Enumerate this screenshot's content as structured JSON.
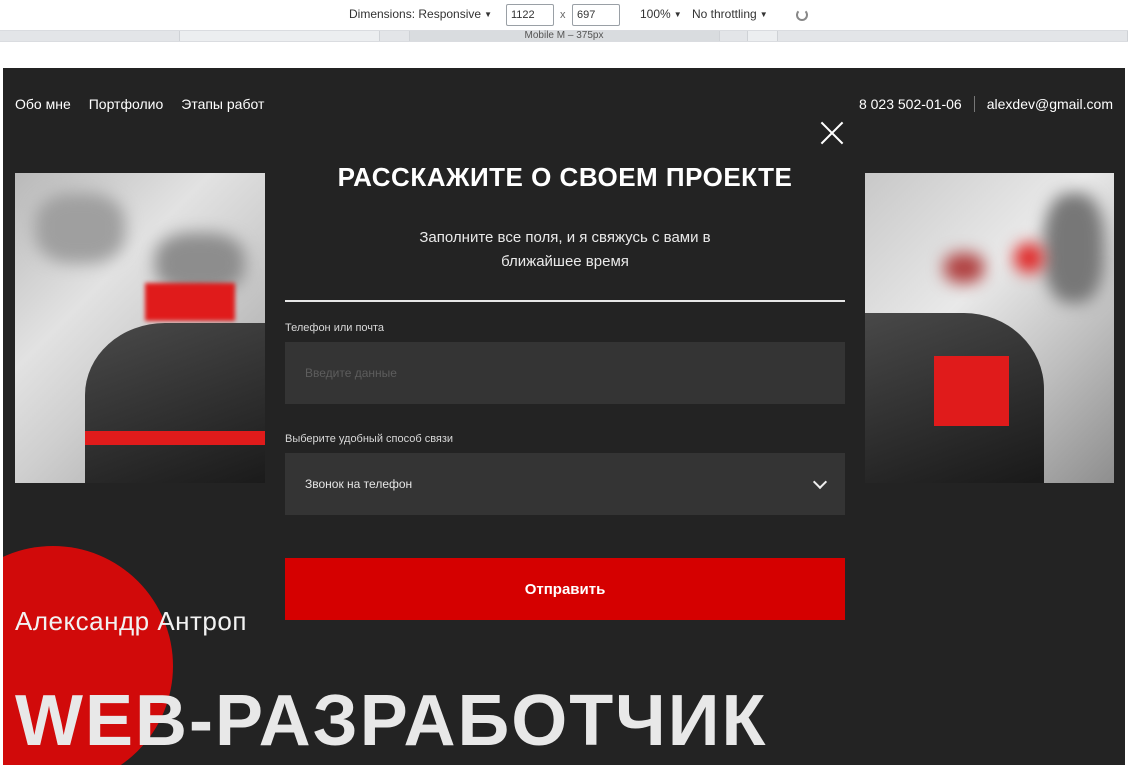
{
  "devtools": {
    "dimensions_label": "Dimensions: Responsive",
    "width_value": "1122",
    "times": "x",
    "height_value": "697",
    "zoom": "100%",
    "throttling": "No throttling",
    "device_label": "Mobile M – 375px"
  },
  "nav": {
    "items": [
      {
        "label": "Обо мне"
      },
      {
        "label": "Портфолио"
      },
      {
        "label": "Этапы работ"
      }
    ]
  },
  "contacts": {
    "phone": "8 023 502-01-06",
    "email": "alexdev@gmail.com"
  },
  "hero": {
    "name": "Александр Антроп",
    "title": "WEB-РАЗРАБОТЧИК"
  },
  "modal": {
    "title": "РАССКАЖИТЕ О СВОЕМ ПРОЕКТЕ",
    "subtitle": "Заполните все поля, и я свяжусь с вами в ближайшее время",
    "field_contact_label": "Телефон или почта",
    "field_contact_placeholder": "Введите данные",
    "field_method_label": "Выберите удобный способ связи",
    "field_method_value": "Звонок на телефон",
    "submit_label": "Отправить"
  },
  "colors": {
    "background": "#232323",
    "accent": "#d50000",
    "input": "#343434"
  }
}
